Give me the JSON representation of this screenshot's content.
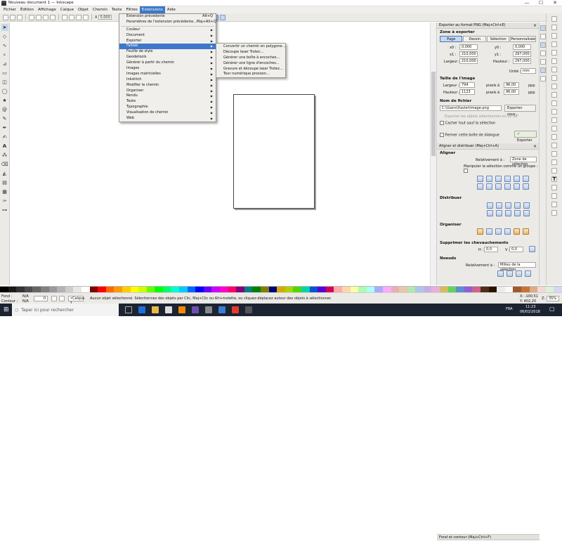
{
  "window": {
    "title": "Nouveau document 1 — Inkscape",
    "controls": [
      "—",
      "☐",
      "✕"
    ]
  },
  "menubar": [
    "Fichier",
    "Édition",
    "Affichage",
    "Calque",
    "Objet",
    "Chemin",
    "Texte",
    "Filtres",
    "Extensions",
    "Aide"
  ],
  "toolbar": {
    "x_label": "X",
    "x_value": "0,000"
  },
  "extensions_menu": {
    "items": [
      {
        "label": "Extension précédente",
        "shortcut": "Alt+Q",
        "submenu": false
      },
      {
        "label": "Paramètres de l'extension précédente...",
        "shortcut": "Maj+Alt+Q",
        "submenu": false
      },
      {
        "divider": true
      },
      {
        "label": "Couleur",
        "submenu": true
      },
      {
        "label": "Document",
        "submenu": true
      },
      {
        "label": "Exporter",
        "submenu": true
      },
      {
        "label": "Fablab",
        "submenu": true,
        "highlighted": true
      },
      {
        "label": "Feuille de style",
        "submenu": true
      },
      {
        "label": "Geodetools",
        "submenu": true
      },
      {
        "label": "Générer à partir du chemin",
        "submenu": true
      },
      {
        "label": "Images",
        "submenu": true
      },
      {
        "label": "Images matricielles",
        "submenu": true
      },
      {
        "label": "Inkstitch",
        "submenu": true
      },
      {
        "label": "Modifier le chemin",
        "submenu": true
      },
      {
        "label": "Organiser",
        "submenu": true
      },
      {
        "label": "Rendu",
        "submenu": true
      },
      {
        "label": "Texte",
        "submenu": true
      },
      {
        "label": "Typographie",
        "submenu": true
      },
      {
        "label": "Visualisation de chemin",
        "submenu": true
      },
      {
        "label": "Web",
        "submenu": true
      }
    ]
  },
  "fablab_submenu": [
    "Convertir un chemin en polygone...",
    "Découpe laser Trotec...",
    "Générer une boîte à encoches...",
    "Générer une ligne d'encoches...",
    "Gravure et découpe laser Trotec...",
    "Tour numérique prosoon..."
  ],
  "export_panel": {
    "header": "Exporter au format PNG (Maj+Ctrl+E)",
    "zone_title": "Zone à exporter",
    "zone_buttons": [
      "Page",
      "Dessin",
      "Sélection",
      "Personnalisée"
    ],
    "active_zone": "Page",
    "x0_label": "x0 :",
    "x0": "0,000",
    "y0_label": "y0 :",
    "y0": "0,000",
    "x1_label": "x1 :",
    "x1": "210,000",
    "y1_label": "y1 :",
    "y1": "297,000",
    "width_label": "Largeur :",
    "width": "210,000",
    "height_label": "Hauteur :",
    "height": "297,000",
    "units_label": "Unité :",
    "units": "mm",
    "size_title": "Taille de l'image",
    "img_width_label": "Largeur :",
    "img_width": "794",
    "img_height_label": "Hauteur :",
    "img_height": "1123",
    "px_at": "pixels à",
    "dpi": "96,00",
    "dpi_unit": "ppp",
    "filename_title": "Nom de fichier",
    "filename": "C:\\Users\\Xavier\\image.png",
    "export_as_btn": "Exporter sous...",
    "batch_label": "Exporter les objets sélectionnés en un lot",
    "hide_label": "Cacher tout sauf la sélection",
    "close_label": "Fermer cette boîte de dialogue",
    "export_btn": "Exporter"
  },
  "align_panel": {
    "header": "Aligner et distribuer (Maj+Ctrl+A)",
    "align_title": "Aligner",
    "relative_label": "Relativement à :",
    "relative_value": "Zone de sélection",
    "group_label": "Manipuler la sélection comme un groupe :",
    "distribute_title": "Distribuer",
    "arrange_title": "Organiser",
    "overlap_title": "Supprimer les chevauchements",
    "h_label": "H :",
    "h_value": "0,0",
    "v_label": "V :",
    "v_value": "0,0",
    "nodes_title": "Noeuds",
    "nodes_relative_label": "Relativement à :",
    "nodes_relative_value": "Milieu de la sélection"
  },
  "fill_panel_header": "Fond et contour (Maj+Ctrl+F)",
  "status": {
    "fill_label": "Fond :",
    "fill_value": "N/A",
    "stroke_label": "Contour :",
    "stroke_value": "N/A",
    "opacity": "0",
    "layer": "•Calque 1",
    "message": "Aucun objet sélectionné. Sélectionnez des objets par Clic, Maj+Clic ou Alt+molette, ou cliquez-déplacez autour des objets à sélectionner.",
    "x_coord": "X: -100,51",
    "y_coord": "Y: 402,20",
    "zoom_label": "Z:",
    "zoom": "35%"
  },
  "taskbar": {
    "search_placeholder": "Taper ici pour rechercher",
    "lang": "FRA",
    "time": "11:23",
    "date": "06/02/2018"
  },
  "palette": [
    "#000000",
    "#1a1a1a",
    "#333333",
    "#4d4d4d",
    "#666666",
    "#808080",
    "#999999",
    "#b3b3b3",
    "#cccccc",
    "#e6e6e6",
    "#ffffff",
    "#800000",
    "#ff0000",
    "#ff6600",
    "#ff9900",
    "#ffcc00",
    "#ffff00",
    "#ccff00",
    "#66ff00",
    "#00ff00",
    "#00ff66",
    "#00ffcc",
    "#00ccff",
    "#0066ff",
    "#0000ff",
    "#6600ff",
    "#cc00ff",
    "#ff00cc",
    "#ff0066",
    "#800080",
    "#008080",
    "#008000",
    "#808000",
    "#000080",
    "#d4aa00",
    "#aad400",
    "#55d400",
    "#00d4aa",
    "#0055d4",
    "#5500d4",
    "#d40055",
    "#ffaaaa",
    "#ffd5aa",
    "#ffffaa",
    "#aaffaa",
    "#aaffff",
    "#aaaaff",
    "#ffaaff",
    "#e9afaf",
    "#e9c6af",
    "#afe9af",
    "#afc6e9",
    "#c6afe9",
    "#e9afdd",
    "#d3bc5f",
    "#5fd35f",
    "#5f8dd3",
    "#8d5fd3",
    "#d35f8d",
    "#502d16",
    "#2b1100",
    "#ececec",
    "#f9f9f9",
    "#a05a2c",
    "#c87137",
    "#deaa87",
    "#f4d7d7",
    "#d7f4d7",
    "#d7d7f4"
  ]
}
